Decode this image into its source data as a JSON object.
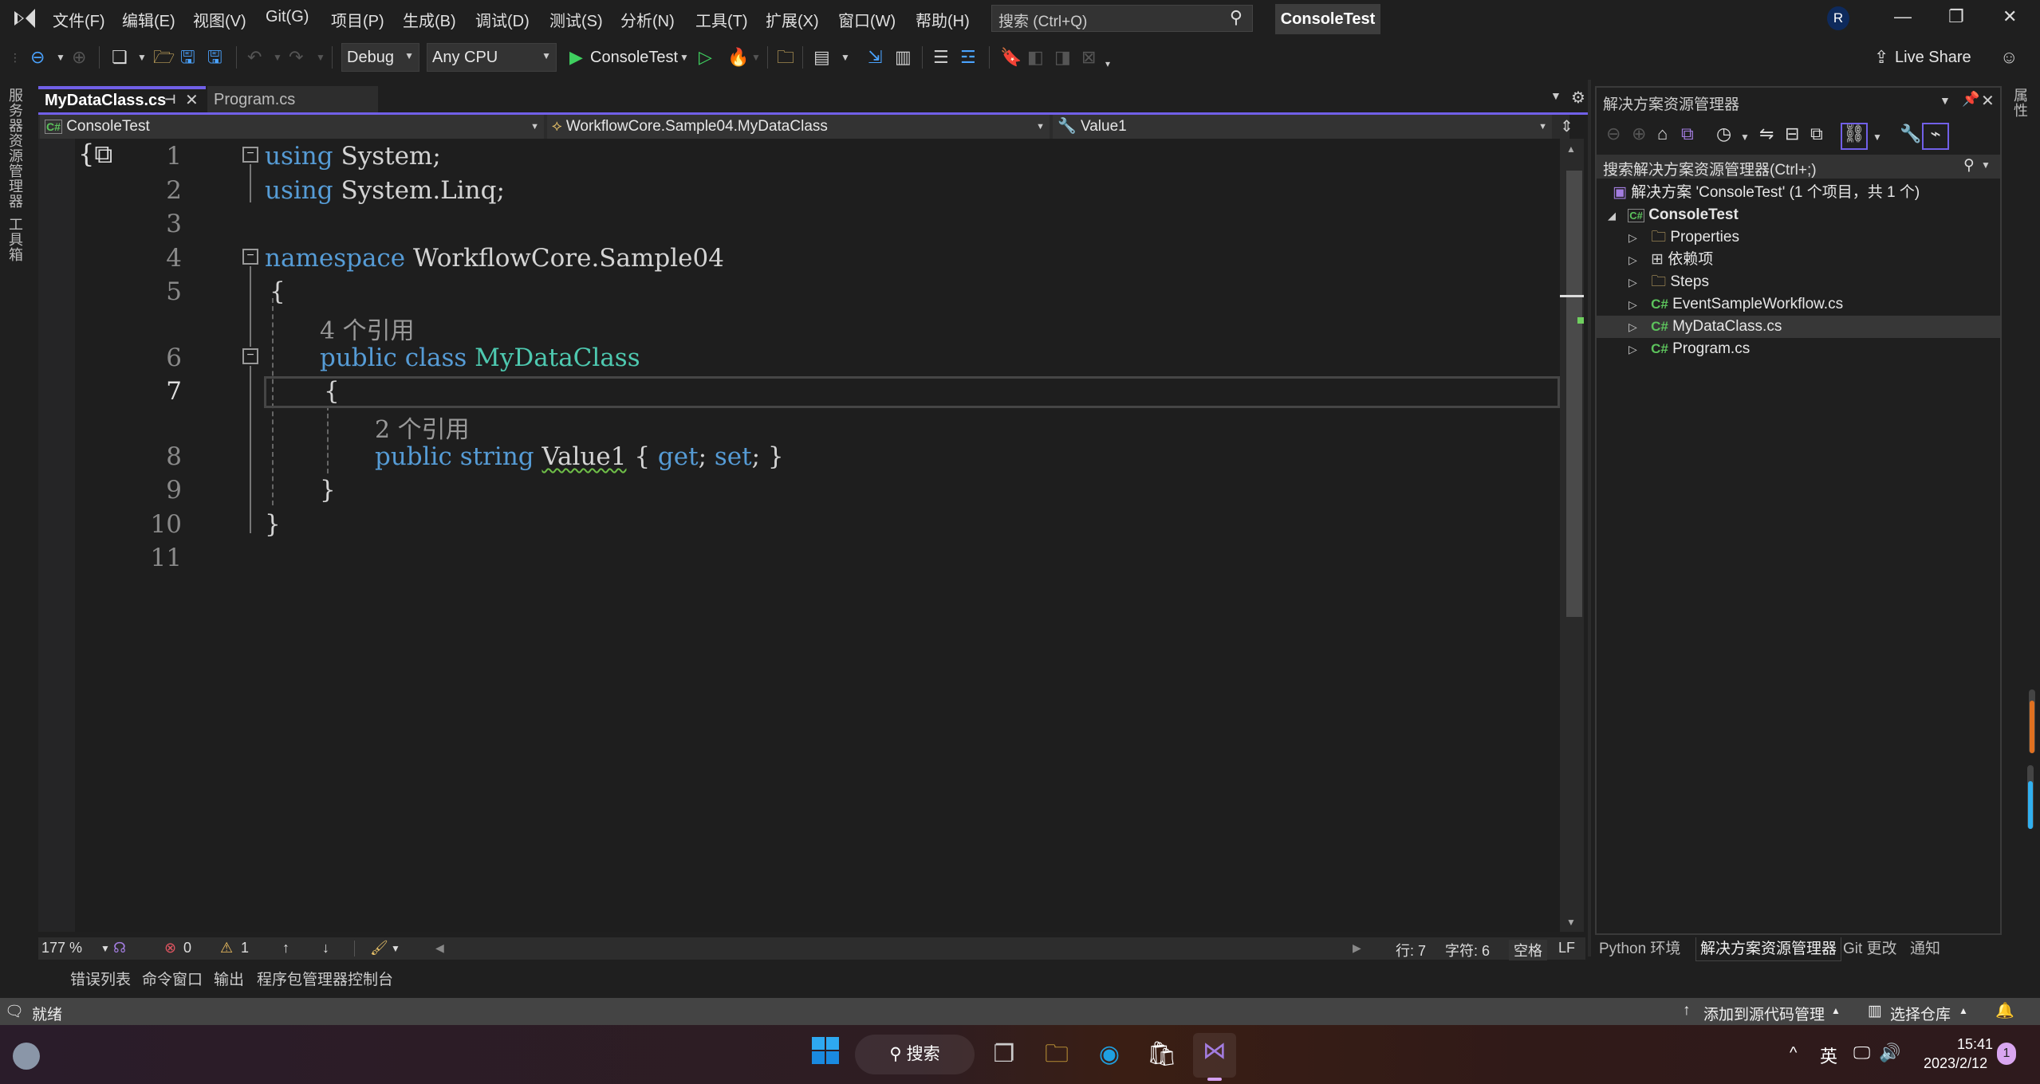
{
  "titlebar": {
    "menu": [
      "文件(F)",
      "编辑(E)",
      "视图(V)",
      "Git(G)",
      "项目(P)",
      "生成(B)",
      "调试(D)",
      "测试(S)",
      "分析(N)",
      "工具(T)",
      "扩展(X)",
      "窗口(W)",
      "帮助(H)"
    ],
    "search_placeholder": "搜索 (Ctrl+Q)",
    "solution_name": "ConsoleTest",
    "avatar_initial": "R"
  },
  "toolbar": {
    "configuration": "Debug",
    "platform": "Any CPU",
    "start_target": "ConsoleTest",
    "live_share": "Live Share"
  },
  "left_rail": {
    "tabs": [
      "服务器资源管理器",
      "工具箱"
    ]
  },
  "right_rail": {
    "tabs": [
      "属性"
    ]
  },
  "doc_tabs": [
    {
      "label": "MyDataClass.cs",
      "active": true
    },
    {
      "label": "Program.cs",
      "active": false
    }
  ],
  "navbar": {
    "project": "ConsoleTest",
    "type": "WorkflowCore.Sample04.MyDataClass",
    "member": "Value1"
  },
  "editor": {
    "current_line": 7,
    "lines": [
      {
        "n": "1"
      },
      {
        "n": "2"
      },
      {
        "n": "3"
      },
      {
        "n": "4"
      },
      {
        "n": "5"
      },
      {
        "n": "6"
      },
      {
        "n": "7"
      },
      {
        "n": "8"
      },
      {
        "n": "9"
      },
      {
        "n": "10"
      },
      {
        "n": "11"
      }
    ],
    "code": {
      "l1_kw": "using",
      "l1_rest": " System;",
      "l2_kw": "using",
      "l2_rest": " System.Linq;",
      "l4_kw": "namespace",
      "l4_rest": " WorkflowCore.Sample04",
      "l5": "{",
      "lens1": "4 个引用",
      "l6_kw1": "public",
      "l6_kw2": "class",
      "l6_type": "MyDataClass",
      "l7": "{",
      "lens2": "2 个引用",
      "l8_kw1": "public",
      "l8_kw2": "string",
      "l8_name": "Value1",
      "l8_b1": " { ",
      "l8_get": "get",
      "l8_semi1": "; ",
      "l8_set": "set",
      "l8_end": "; }",
      "l9": "}",
      "l10": "}"
    }
  },
  "editor_status": {
    "zoom": "177 %",
    "errors": "0",
    "warnings": "1",
    "line": "行: 7",
    "char": "字符: 6",
    "indent": "空格",
    "eol": "LF"
  },
  "bottom_tabs": [
    "错误列表",
    "命令窗口",
    "输出",
    "程序包管理器控制台"
  ],
  "solution_explorer": {
    "title": "解决方案资源管理器",
    "search_placeholder": "搜索解决方案资源管理器(Ctrl+;)",
    "solution_label": "解决方案 'ConsoleTest' (1 个项目，共 1 个)",
    "project": "ConsoleTest",
    "items": [
      {
        "label": "Properties",
        "icon": "properties-folder-icon"
      },
      {
        "label": "依赖项",
        "icon": "dependencies-icon"
      },
      {
        "label": "Steps",
        "icon": "folder-icon"
      },
      {
        "label": "EventSampleWorkflow.cs",
        "icon": "csharp-file-icon"
      },
      {
        "label": "MyDataClass.cs",
        "icon": "csharp-file-icon",
        "selected": true
      },
      {
        "label": "Program.cs",
        "icon": "csharp-file-icon"
      }
    ],
    "bottom_tabs": [
      "Python 环境",
      "解决方案资源管理器",
      "Git 更改",
      "通知"
    ]
  },
  "statusbar": {
    "ready": "就绪",
    "add_source_control": "添加到源代码管理",
    "select_repo": "选择仓库"
  },
  "taskbar": {
    "search": "搜索",
    "ime": "英",
    "time": "15:41",
    "date": "2023/2/12",
    "notification_count": "1"
  },
  "colors": {
    "accent": "#7160e8",
    "keyword": "#569cd6",
    "type": "#4ec9b0"
  }
}
